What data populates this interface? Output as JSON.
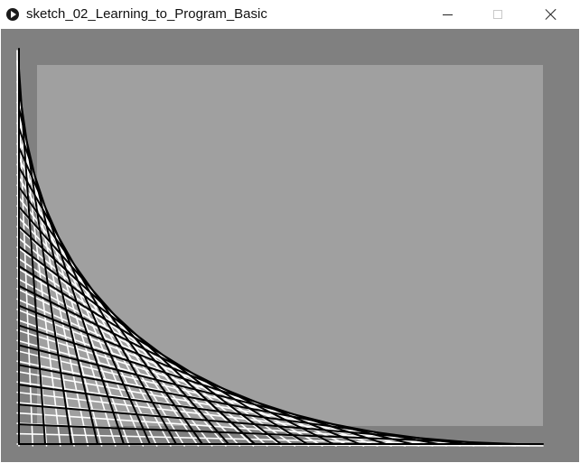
{
  "window": {
    "title": "sketch_02_Learning_to_Program_Basic",
    "icon": "processing-play-icon",
    "controls": [
      "minimize-icon",
      "maximize-icon",
      "close-icon"
    ]
  },
  "sketch": {
    "background_color": "#808080",
    "panel_color": "#a0a0a0",
    "white_grid_color": "#ffffff",
    "string_art_color": "#000000",
    "string_art_lines": 20,
    "white_grid_lines": 38
  }
}
